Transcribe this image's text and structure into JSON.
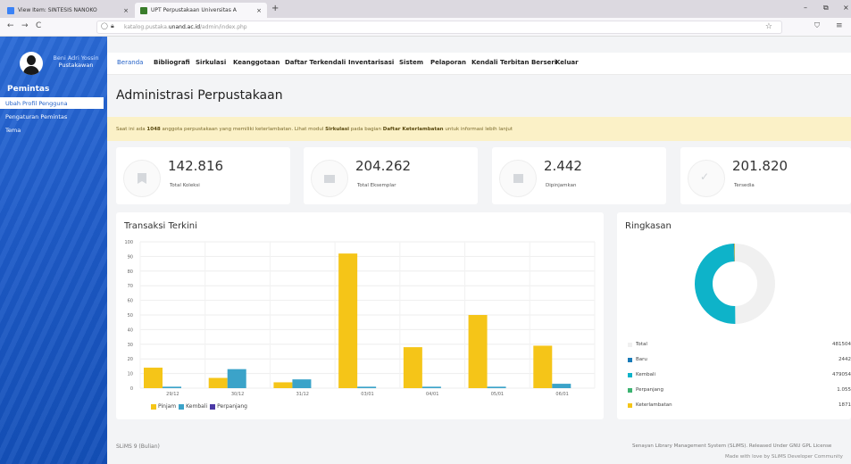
{
  "browser": {
    "tabs": [
      {
        "label": "View Item: SINTESIS NANOKO",
        "close": "×",
        "icon_color": "#3b82f6"
      },
      {
        "label": "UPT Perpustakaan Universitas A",
        "close": "×",
        "icon_color": "#3a7d2c"
      }
    ],
    "new_tab": "+",
    "window_controls": [
      "–",
      "⧉",
      "×"
    ],
    "nav": {
      "back": "←",
      "forward": "→",
      "reload": "C"
    },
    "url_prefix": "katalog.pustaka.",
    "url_host": "unand.ac.id",
    "url_path": "/admin/index.php",
    "star": "☆",
    "pocket": "⛉",
    "menu": "≡"
  },
  "user": {
    "name": "Beni Adri Yossin",
    "role": "Pustakawan"
  },
  "sidebar": {
    "heading": "Pemintas",
    "items": [
      {
        "label": "Ubah Profil Pengguna",
        "active": true
      },
      {
        "label": "Pengaturan Pemintas",
        "active": false
      },
      {
        "label": "Tema",
        "active": false
      }
    ]
  },
  "topnav": [
    "Beranda",
    "Bibliografi",
    "Sirkulasi",
    "Keanggotaan",
    "Daftar Terkendali",
    "Inventarisasi",
    "Sistem",
    "Pelaporan",
    "Kendali Terbitan Berseri",
    "Keluar"
  ],
  "page_title": "Administrasi Perpustakaan",
  "alert": {
    "pre": "Saat ini ada ",
    "count": "1048",
    "mid": " anggota perpustakaan yang memiliki keterlambatan. Lihat modul ",
    "module": "Sirkulasi",
    "mid2": " pada bagian ",
    "section": "Daftar Keterlambatan",
    "post": " untuk informasi lebih lanjut"
  },
  "stats": [
    {
      "value": "142.816",
      "label": "Total Koleksi",
      "icon": "bookmark-icon"
    },
    {
      "value": "204.262",
      "label": "Total Eksemplar",
      "icon": "book-stack-icon"
    },
    {
      "value": "2.442",
      "label": "Dipinjamkan",
      "icon": "checkout-icon"
    },
    {
      "value": "201.820",
      "label": "Tersedia",
      "icon": "check-icon"
    }
  ],
  "transactions_title": "Transaksi Terkini",
  "summary_title": "Ringkasan",
  "chart_data": [
    {
      "type": "bar",
      "title": "Transaksi Terkini",
      "categories": [
        "29/12",
        "30/12",
        "31/12",
        "03/01",
        "04/01",
        "05/01",
        "06/01"
      ],
      "series": [
        {
          "name": "Pinjam",
          "color": "#f5c518",
          "values": [
            14,
            7,
            4,
            92,
            28,
            50,
            29
          ]
        },
        {
          "name": "Kembali",
          "color": "#3ba3c9",
          "values": [
            1,
            13,
            6,
            1,
            1,
            1,
            3
          ]
        },
        {
          "name": "Perpanjang",
          "color": "#4b3aa6",
          "values": [
            0,
            0,
            0,
            0,
            0,
            0,
            0
          ]
        }
      ],
      "y_ticks": [
        0,
        10,
        20,
        30,
        40,
        50,
        60,
        70,
        80,
        90,
        100
      ],
      "ylim": [
        0,
        100
      ],
      "grid": true,
      "legend": "bottom-left"
    },
    {
      "type": "pie",
      "title": "Ringkasan",
      "labels": [
        "Total",
        "Baru",
        "Kembali",
        "Perpanjang",
        "Keterlambatan"
      ],
      "values": [
        481504,
        2442,
        479054,
        1055,
        1871
      ],
      "display_values": [
        "481504",
        "2442",
        "479054",
        "1.055",
        "1871"
      ],
      "colors": [
        "#f0f0f0",
        "#1a7bb8",
        "#0eb3c9",
        "#3cb371",
        "#f5c518"
      ]
    }
  ],
  "footer": {
    "left": "SLiMS 9 (Bulian)",
    "right1": "Senayan Library Management System (SLiMS). Released Under GNU GPL License",
    "right2": "Made with love by SLiMS Developer Community"
  }
}
